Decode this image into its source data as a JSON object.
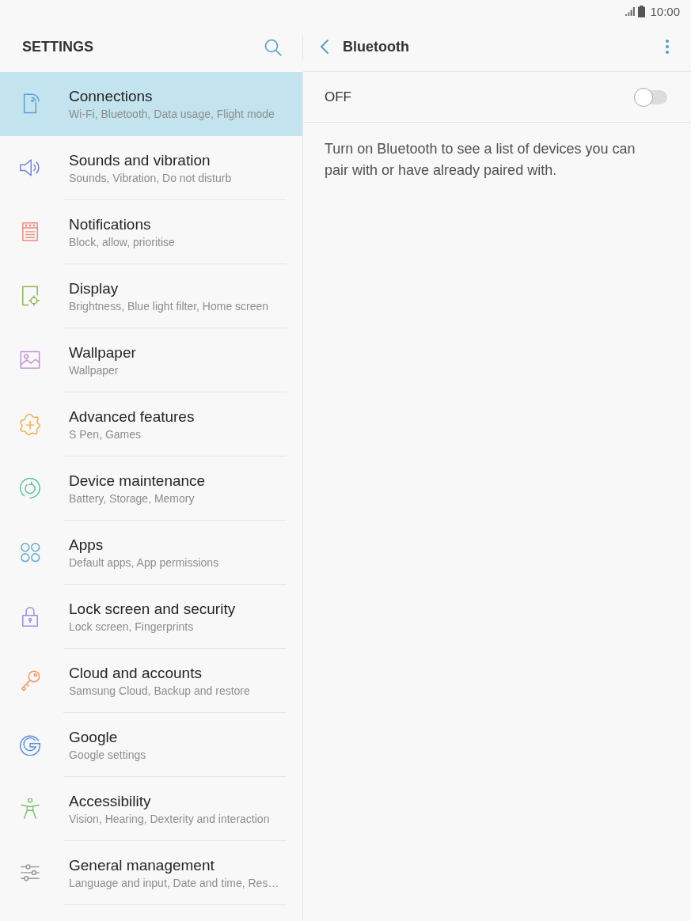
{
  "status_bar": {
    "time": "10:00"
  },
  "sidebar": {
    "title": "SETTINGS",
    "items": [
      {
        "title": "Connections",
        "subtitle": "Wi-Fi, Bluetooth, Data usage, Flight mode",
        "selected": true
      },
      {
        "title": "Sounds and vibration",
        "subtitle": "Sounds, Vibration, Do not disturb",
        "selected": false
      },
      {
        "title": "Notifications",
        "subtitle": "Block, allow, prioritise",
        "selected": false
      },
      {
        "title": "Display",
        "subtitle": "Brightness, Blue light filter, Home screen",
        "selected": false
      },
      {
        "title": "Wallpaper",
        "subtitle": "Wallpaper",
        "selected": false
      },
      {
        "title": "Advanced features",
        "subtitle": "S Pen, Games",
        "selected": false
      },
      {
        "title": "Device maintenance",
        "subtitle": "Battery, Storage, Memory",
        "selected": false
      },
      {
        "title": "Apps",
        "subtitle": "Default apps, App permissions",
        "selected": false
      },
      {
        "title": "Lock screen and security",
        "subtitle": "Lock screen, Fingerprints",
        "selected": false
      },
      {
        "title": "Cloud and accounts",
        "subtitle": "Samsung Cloud, Backup and restore",
        "selected": false
      },
      {
        "title": "Google",
        "subtitle": "Google settings",
        "selected": false
      },
      {
        "title": "Accessibility",
        "subtitle": "Vision, Hearing, Dexterity and interaction",
        "selected": false
      },
      {
        "title": "General management",
        "subtitle": "Language and input, Date and time, Res…",
        "selected": false
      }
    ]
  },
  "detail": {
    "title": "Bluetooth",
    "switch": {
      "label": "OFF",
      "on": false
    },
    "description": "Turn on Bluetooth to see a list of devices you can pair with or have already paired with."
  }
}
